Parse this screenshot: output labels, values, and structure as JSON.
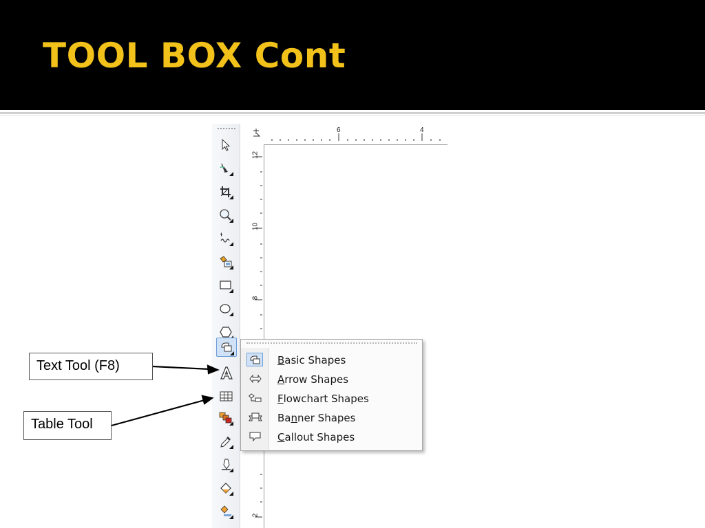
{
  "slide": {
    "title": "TOOL BOX Cont",
    "colors": {
      "title": "#f2c21b",
      "header_bg": "#000000",
      "accent": "#6f9fd8"
    }
  },
  "ruler": {
    "top_labels": [
      "6",
      "4"
    ],
    "left_labels": [
      "12",
      "10",
      "8",
      "2"
    ]
  },
  "toolbox": {
    "tools": [
      {
        "name": "pick-tool-icon"
      },
      {
        "name": "shape-tool-icon"
      },
      {
        "name": "crop-tool-icon"
      },
      {
        "name": "zoom-tool-icon"
      },
      {
        "name": "freehand-tool-icon"
      },
      {
        "name": "smart-fill-tool-icon"
      },
      {
        "name": "rectangle-tool-icon"
      },
      {
        "name": "ellipse-tool-icon"
      },
      {
        "name": "polygon-tool-icon"
      },
      {
        "name": "basic-shapes-tool-icon"
      },
      {
        "name": "text-tool-icon"
      },
      {
        "name": "table-tool-icon"
      },
      {
        "name": "interactive-blend-tool-icon"
      },
      {
        "name": "eyedropper-tool-icon"
      },
      {
        "name": "outline-pen-tool-icon"
      },
      {
        "name": "fill-tool-icon"
      },
      {
        "name": "interactive-fill-tool-icon"
      }
    ]
  },
  "flyout": {
    "items": [
      {
        "pre": "",
        "key": "B",
        "post": "asic Shapes",
        "icon": "basic-shapes-icon"
      },
      {
        "pre": "",
        "key": "A",
        "post": "rrow Shapes",
        "icon": "arrow-shapes-icon"
      },
      {
        "pre": "",
        "key": "F",
        "post": "lowchart Shapes",
        "icon": "flowchart-shapes-icon"
      },
      {
        "pre": "Ba",
        "key": "n",
        "post": "ner Shapes",
        "icon": "banner-shapes-icon"
      },
      {
        "pre": "",
        "key": "C",
        "post": "allout Shapes",
        "icon": "callout-shapes-icon"
      }
    ]
  },
  "callouts": {
    "text_tool": "Text Tool (F8)",
    "table_tool": "Table Tool"
  }
}
